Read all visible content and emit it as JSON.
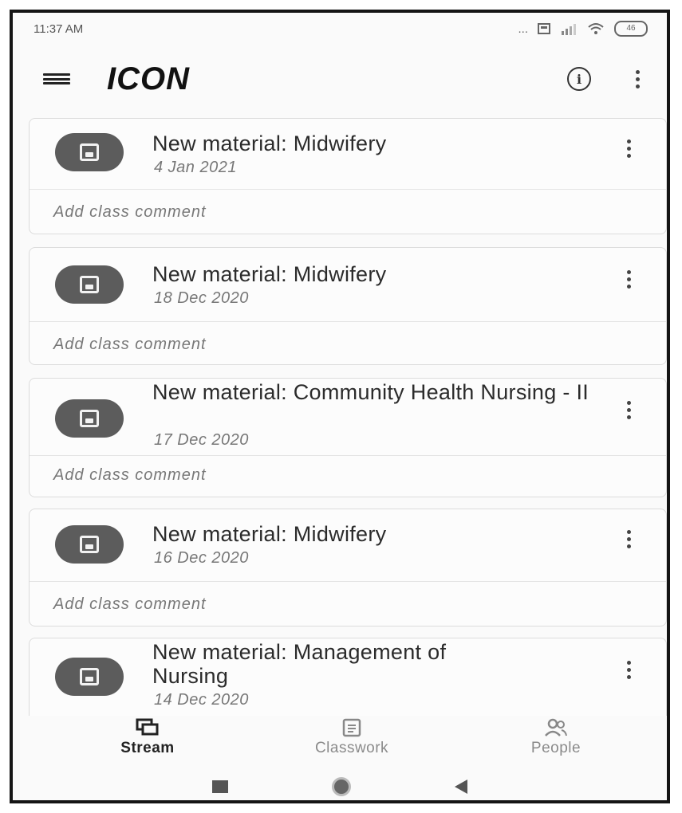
{
  "status_bar": {
    "time": "11:37 AM",
    "signal_text": "...",
    "battery": "46"
  },
  "app_bar": {
    "title": "ICON"
  },
  "stream": {
    "posts": [
      {
        "title": "New material: Midwifery",
        "date": "4 Jan 2021",
        "comment_placeholder": "Add class comment"
      },
      {
        "title": "New material: Midwifery",
        "date": "18 Dec 2020",
        "comment_placeholder": "Add class comment"
      },
      {
        "title": "New material: Community Health Nursing - II",
        "date": "17 Dec 2020",
        "comment_placeholder": "Add class comment"
      },
      {
        "title": "New material: Midwifery",
        "date": "16 Dec 2020",
        "comment_placeholder": "Add class comment"
      },
      {
        "title": "New material: Management of Nursing",
        "date": "14 Dec 2020"
      }
    ]
  },
  "bottom_nav": {
    "items": [
      {
        "label": "Stream",
        "icon": "stream-icon",
        "active": true
      },
      {
        "label": "Classwork",
        "icon": "classwork-icon",
        "active": false
      },
      {
        "label": "People",
        "icon": "people-icon",
        "active": false
      }
    ]
  },
  "colors": {
    "avatar": "#5c5c5c",
    "background": "#fafafa",
    "text": "#2b2b2b",
    "muted": "#777777"
  }
}
